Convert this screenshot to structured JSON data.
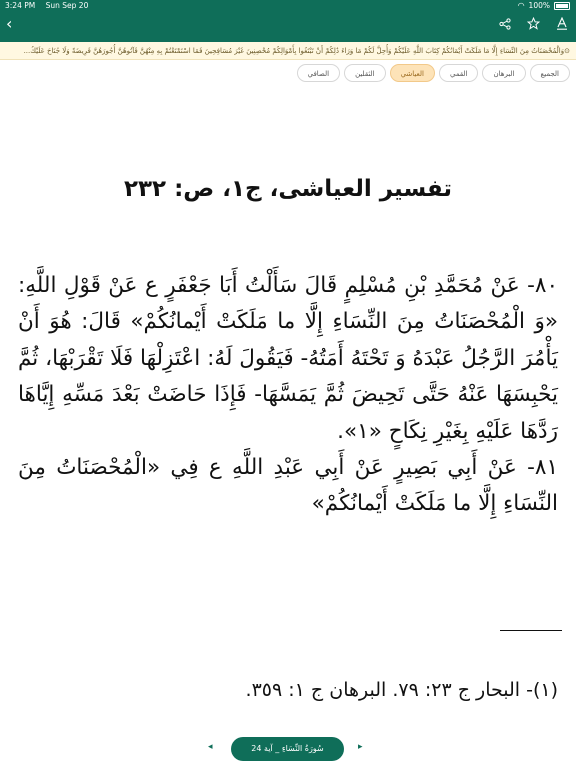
{
  "status_bar": {
    "time": "3:24 PM",
    "date": "Sun Sep 20",
    "battery": "100%"
  },
  "verse_strip": {
    "text": "⊙وَالْمُحْصَنَاتُ مِنَ النِّسَاءِ إِلَّا مَا مَلَكَتْ أَيْمَانُكُمْ كِتَابَ اللَّهِ عَلَيْكُمْ وَأُحِلَّ لَكُمْ مَا وَرَاءَ ذَٰلِكُمْ أَنْ تَبْتَغُوا بِأَمْوَالِكُمْ مُحْصِنِينَ غَيْرَ مُسَافِحِينَ فَمَا اسْتَمْتَعْتُمْ بِهِ مِنْهُنَّ فَآتُوهُنَّ أُجُورَهُنَّ فَرِيضَةً وَلَا جُنَاحَ عَلَيْكُ..."
  },
  "tabs": [
    {
      "label": "الجميع",
      "active": false
    },
    {
      "label": "البرهان",
      "active": false
    },
    {
      "label": "القمي",
      "active": false
    },
    {
      "label": "العياشي",
      "active": true
    },
    {
      "label": "الثقلين",
      "active": false
    },
    {
      "label": "الصافي",
      "active": false
    }
  ],
  "main": {
    "title": "تفسير العياشى، ج١، ص: ٢٣٢",
    "paragraph1": "٨٠- عَنْ مُحَمَّدِ بْنِ مُسْلِمٍ قَالَ سَأَلْتُ أَبَا جَعْفَرٍ ع عَنْ قَوْلِ اللَّهِ: «وَ الْمُحْصَنَاتُ مِنَ النِّسَاءِ إِلَّا ما مَلَكَتْ أَيْمانُكُمْ» قَالَ: هُوَ أَنْ يَأْمُرَ الرَّجُلُ عَبْدَهُ وَ تَحْتَهُ أَمَتُهُ- فَيَقُولَ لَهُ: اعْتَزِلْهَا فَلَا تَقْرَبْهَا، ثُمَّ يَحْبِسَهَا عَنْهُ حَتَّى تَحِيضَ ثُمَّ يَمَسَّهَا- فَإِذَا حَاضَتْ بَعْدَ مَسِّهِ إِيَّاهَا رَدَّهَا عَلَيْهِ بِغَيْرِ نِكَاحٍ «١».",
    "paragraph2": "٨١- عَنْ أَبِي بَصِيرٍ عَنْ أَبِي عَبْدِ اللَّهِ ع فِي «الْمُحْصَنَاتُ مِنَ النِّسَاءِ إِلَّا ما مَلَكَتْ أَيْمانُكُمْ»",
    "footnote": "(١)- البحار ج ٢٣: ٧٩. البرهان ج ١: ٣٥٩."
  },
  "pager": {
    "label": "سُورَةُ النِّسَاءِ _ آية 24"
  },
  "colors": {
    "primary": "#0f6e59",
    "active_tab_bg": "#fde3b8",
    "strip_bg": "#fff8e1"
  },
  "icons": [
    "back-icon",
    "share-icon",
    "star-icon",
    "font-size-icon",
    "wifi-icon",
    "battery-icon",
    "prev-icon",
    "next-icon"
  ]
}
